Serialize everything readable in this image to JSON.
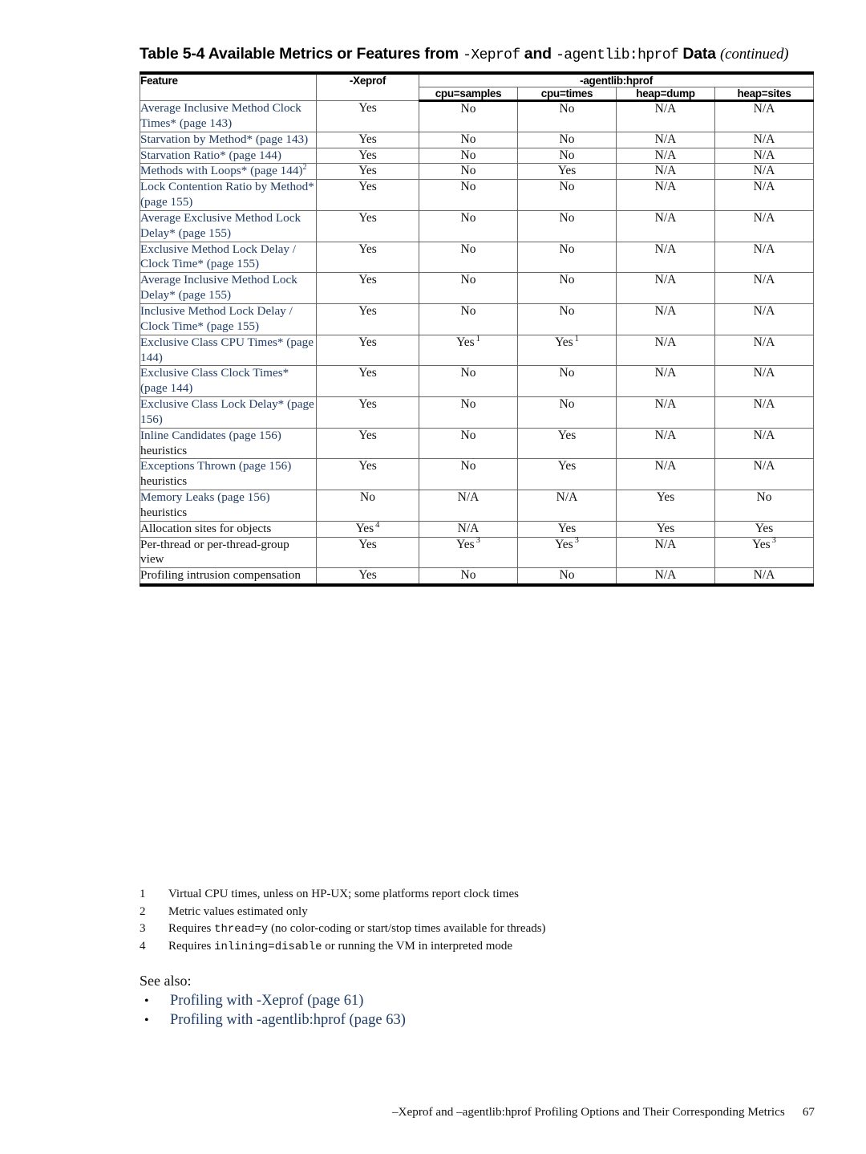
{
  "table": {
    "caption": {
      "prefix": "Table 5-4 Available Metrics or Features from ",
      "code1": "-Xeprof",
      "mid": " and ",
      "code2": "-agentlib:hprof",
      "suffix": " Data ",
      "continued": "(continued)"
    },
    "headers": {
      "feature": "Feature",
      "xeprof": "-Xeprof",
      "agentlib": "-agentlib:hprof",
      "sub": [
        "cpu=samples",
        "cpu=times",
        "heap=dump",
        "heap=sites"
      ]
    },
    "rows": [
      {
        "feature_link": "Average Inclusive Method Clock Times* (page 143)",
        "feature_plain": "",
        "feature_sup": "",
        "values": [
          {
            "text": "Yes",
            "sup": ""
          },
          {
            "text": "No",
            "sup": ""
          },
          {
            "text": "No",
            "sup": ""
          },
          {
            "text": "N/A",
            "sup": ""
          },
          {
            "text": "N/A",
            "sup": ""
          }
        ]
      },
      {
        "feature_link": "Starvation by Method* (page 143)",
        "feature_plain": "",
        "feature_sup": "",
        "values": [
          {
            "text": "Yes",
            "sup": ""
          },
          {
            "text": "No",
            "sup": ""
          },
          {
            "text": "No",
            "sup": ""
          },
          {
            "text": "N/A",
            "sup": ""
          },
          {
            "text": "N/A",
            "sup": ""
          }
        ]
      },
      {
        "feature_link": "Starvation Ratio* (page 144)",
        "feature_plain": "",
        "feature_sup": "",
        "values": [
          {
            "text": "Yes",
            "sup": ""
          },
          {
            "text": "No",
            "sup": ""
          },
          {
            "text": "No",
            "sup": ""
          },
          {
            "text": "N/A",
            "sup": ""
          },
          {
            "text": "N/A",
            "sup": ""
          }
        ]
      },
      {
        "feature_link": "Methods with Loops* (page 144)",
        "feature_plain": "",
        "feature_sup": "2",
        "values": [
          {
            "text": "Yes",
            "sup": ""
          },
          {
            "text": "No",
            "sup": ""
          },
          {
            "text": "Yes",
            "sup": ""
          },
          {
            "text": "N/A",
            "sup": ""
          },
          {
            "text": "N/A",
            "sup": ""
          }
        ]
      },
      {
        "feature_link": "Lock Contention Ratio by Method* (page 155)",
        "feature_plain": "",
        "feature_sup": "",
        "values": [
          {
            "text": "Yes",
            "sup": ""
          },
          {
            "text": "No",
            "sup": ""
          },
          {
            "text": "No",
            "sup": ""
          },
          {
            "text": "N/A",
            "sup": ""
          },
          {
            "text": "N/A",
            "sup": ""
          }
        ]
      },
      {
        "feature_link": "Average Exclusive Method Lock Delay* (page 155)",
        "feature_plain": "",
        "feature_sup": "",
        "values": [
          {
            "text": "Yes",
            "sup": ""
          },
          {
            "text": "No",
            "sup": ""
          },
          {
            "text": "No",
            "sup": ""
          },
          {
            "text": "N/A",
            "sup": ""
          },
          {
            "text": "N/A",
            "sup": ""
          }
        ]
      },
      {
        "feature_link": "Exclusive Method Lock Delay / Clock Time* (page 155)",
        "feature_plain": "",
        "feature_sup": "",
        "values": [
          {
            "text": "Yes",
            "sup": ""
          },
          {
            "text": "No",
            "sup": ""
          },
          {
            "text": "No",
            "sup": ""
          },
          {
            "text": "N/A",
            "sup": ""
          },
          {
            "text": "N/A",
            "sup": ""
          }
        ]
      },
      {
        "feature_link": "Average Inclusive Method Lock Delay* (page 155)",
        "feature_plain": "",
        "feature_sup": "",
        "values": [
          {
            "text": "Yes",
            "sup": ""
          },
          {
            "text": "No",
            "sup": ""
          },
          {
            "text": "No",
            "sup": ""
          },
          {
            "text": "N/A",
            "sup": ""
          },
          {
            "text": "N/A",
            "sup": ""
          }
        ]
      },
      {
        "feature_link": "Inclusive Method Lock Delay / Clock Time* (page 155)",
        "feature_plain": "",
        "feature_sup": "",
        "values": [
          {
            "text": "Yes",
            "sup": ""
          },
          {
            "text": "No",
            "sup": ""
          },
          {
            "text": "No",
            "sup": ""
          },
          {
            "text": "N/A",
            "sup": ""
          },
          {
            "text": "N/A",
            "sup": ""
          }
        ]
      },
      {
        "feature_link": "Exclusive Class CPU Times* (page 144)",
        "feature_plain": "",
        "feature_sup": "",
        "values": [
          {
            "text": "Yes",
            "sup": ""
          },
          {
            "text": "Yes",
            "sup": "1"
          },
          {
            "text": "Yes",
            "sup": "1"
          },
          {
            "text": "N/A",
            "sup": ""
          },
          {
            "text": "N/A",
            "sup": ""
          }
        ]
      },
      {
        "feature_link": "Exclusive Class Clock Times* (page 144)",
        "feature_plain": "",
        "feature_sup": "",
        "values": [
          {
            "text": "Yes",
            "sup": ""
          },
          {
            "text": "No",
            "sup": ""
          },
          {
            "text": "No",
            "sup": ""
          },
          {
            "text": "N/A",
            "sup": ""
          },
          {
            "text": "N/A",
            "sup": ""
          }
        ]
      },
      {
        "feature_link": "Exclusive Class Lock Delay* (page 156)",
        "feature_plain": "",
        "feature_sup": "",
        "values": [
          {
            "text": "Yes",
            "sup": ""
          },
          {
            "text": "No",
            "sup": ""
          },
          {
            "text": "No",
            "sup": ""
          },
          {
            "text": "N/A",
            "sup": ""
          },
          {
            "text": "N/A",
            "sup": ""
          }
        ]
      },
      {
        "feature_link": "Inline Candidates (page 156)",
        "feature_plain": "heuristics",
        "feature_sup": "",
        "values": [
          {
            "text": "Yes",
            "sup": ""
          },
          {
            "text": "No",
            "sup": ""
          },
          {
            "text": "Yes",
            "sup": ""
          },
          {
            "text": "N/A",
            "sup": ""
          },
          {
            "text": "N/A",
            "sup": ""
          }
        ]
      },
      {
        "feature_link": "Exceptions Thrown (page 156)",
        "feature_plain": "heuristics",
        "feature_sup": "",
        "values": [
          {
            "text": "Yes",
            "sup": ""
          },
          {
            "text": "No",
            "sup": ""
          },
          {
            "text": "Yes",
            "sup": ""
          },
          {
            "text": "N/A",
            "sup": ""
          },
          {
            "text": "N/A",
            "sup": ""
          }
        ]
      },
      {
        "feature_link": "Memory Leaks (page 156)",
        "feature_plain": "heuristics",
        "feature_sup": "",
        "values": [
          {
            "text": "No",
            "sup": ""
          },
          {
            "text": "N/A",
            "sup": ""
          },
          {
            "text": "N/A",
            "sup": ""
          },
          {
            "text": "Yes",
            "sup": ""
          },
          {
            "text": "No",
            "sup": ""
          }
        ]
      },
      {
        "feature_link": "",
        "feature_plain": "Allocation sites for objects",
        "feature_sup": "",
        "values": [
          {
            "text": "Yes",
            "sup": "4"
          },
          {
            "text": "N/A",
            "sup": ""
          },
          {
            "text": "Yes",
            "sup": ""
          },
          {
            "text": "Yes",
            "sup": ""
          },
          {
            "text": "Yes",
            "sup": ""
          }
        ]
      },
      {
        "feature_link": "",
        "feature_plain": "Per-thread or per-thread-group view",
        "feature_sup": "",
        "values": [
          {
            "text": "Yes",
            "sup": ""
          },
          {
            "text": "Yes",
            "sup": "3"
          },
          {
            "text": "Yes",
            "sup": "3"
          },
          {
            "text": "N/A",
            "sup": ""
          },
          {
            "text": "Yes",
            "sup": "3"
          }
        ]
      },
      {
        "feature_link": "",
        "feature_plain": "Profiling intrusion compensation",
        "feature_sup": "",
        "values": [
          {
            "text": "Yes",
            "sup": ""
          },
          {
            "text": "No",
            "sup": ""
          },
          {
            "text": "No",
            "sup": ""
          },
          {
            "text": "N/A",
            "sup": ""
          },
          {
            "text": "N/A",
            "sup": ""
          }
        ]
      }
    ]
  },
  "footnotes": [
    {
      "num": "1",
      "pre": "Virtual CPU times, unless on HP-UX; some platforms report clock times",
      "code": "",
      "post": ""
    },
    {
      "num": "2",
      "pre": "Metric values estimated only",
      "code": "",
      "post": ""
    },
    {
      "num": "3",
      "pre": "Requires ",
      "code": "thread=y",
      "post": " (no color-coding or start/stop times available for threads)"
    },
    {
      "num": "4",
      "pre": "Requires ",
      "code": "inlining=disable",
      "post": " or running the VM in interpreted mode"
    }
  ],
  "see_also": {
    "label": "See also:",
    "bullet": "•",
    "items": [
      "Profiling with -Xeprof (page 61)",
      "Profiling with -agentlib:hprof (page 63)"
    ]
  },
  "footer": {
    "text": "–Xeprof and –agentlib:hprof Profiling Options and Their Corresponding Metrics",
    "page_number": "67"
  }
}
